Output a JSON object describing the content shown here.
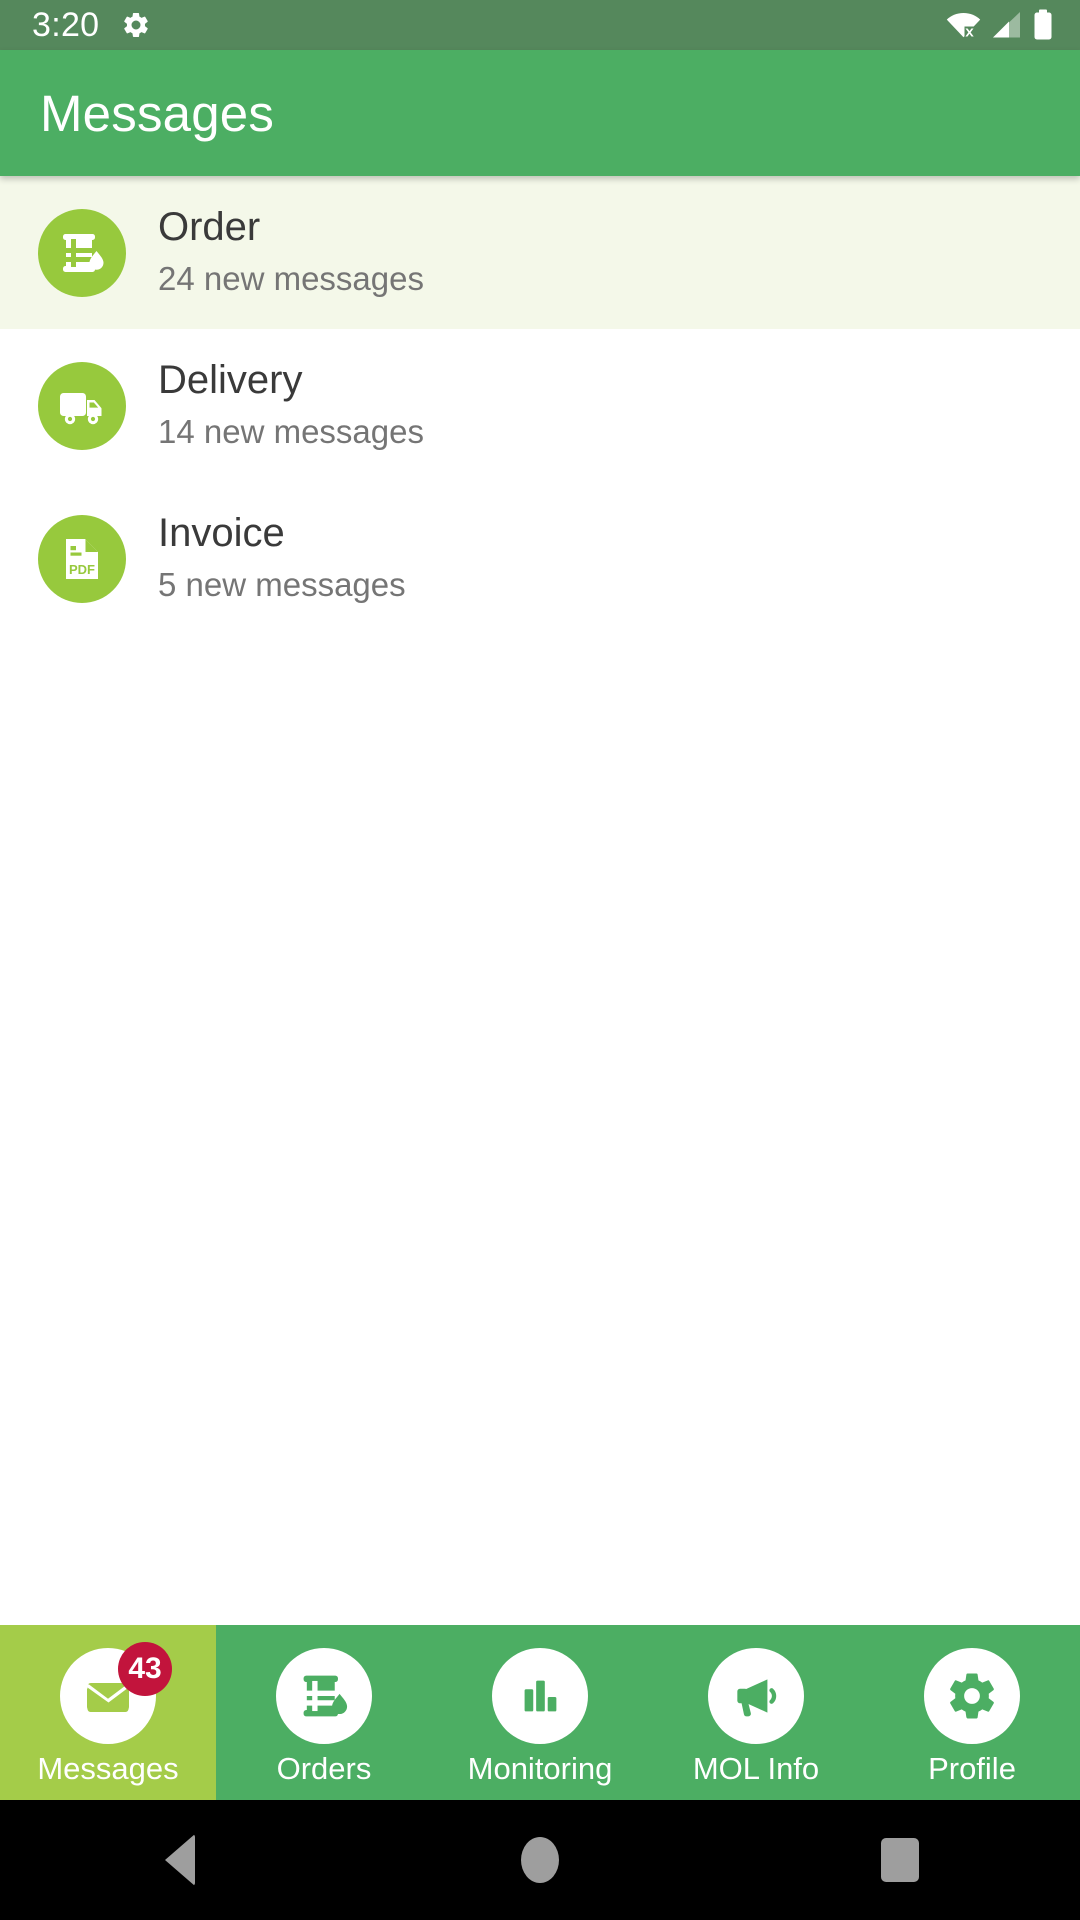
{
  "status_bar": {
    "time": "3:20",
    "icons": {
      "settings": "gear-icon",
      "wifi": "wifi-no-connection-icon",
      "signal": "cellular-signal-icon",
      "battery": "battery-full-icon"
    }
  },
  "app_bar": {
    "title": "Messages"
  },
  "messages": {
    "items": [
      {
        "title": "Order",
        "subtitle": "24 new messages",
        "icon": "oil-barrel-droplet-icon",
        "selected": true
      },
      {
        "title": "Delivery",
        "subtitle": "14 new messages",
        "icon": "delivery-truck-icon",
        "selected": false
      },
      {
        "title": "Invoice",
        "subtitle": "5 new messages",
        "icon": "pdf-document-icon",
        "selected": false
      }
    ]
  },
  "bottom_nav": {
    "items": [
      {
        "label": "Messages",
        "icon": "envelope-icon",
        "badge": "43",
        "active": true
      },
      {
        "label": "Orders",
        "icon": "oil-barrel-droplet-icon",
        "badge": "",
        "active": false
      },
      {
        "label": "Monitoring",
        "icon": "bar-chart-icon",
        "badge": "",
        "active": false
      },
      {
        "label": "MOL Info",
        "icon": "megaphone-icon",
        "badge": "",
        "active": false
      },
      {
        "label": "Profile",
        "icon": "gear-icon",
        "badge": "",
        "active": false
      }
    ]
  },
  "system_nav": {
    "back": "back-triangle",
    "home": "home-circle",
    "recents": "recents-square"
  },
  "colors": {
    "status_bar": "#55885C",
    "app_bar": "#4CAE63",
    "accent_green": "#97C93D",
    "nav_active": "#A4CC49",
    "selected_row": "#F4F8E9",
    "badge_red": "#C2143C",
    "title_text": "#3A3A3A",
    "subtitle_text": "#757575"
  }
}
